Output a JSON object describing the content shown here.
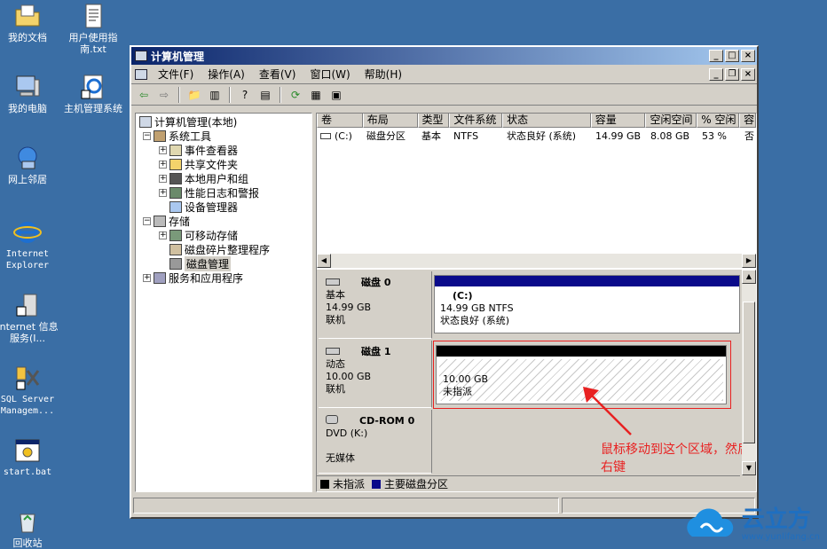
{
  "desktop": {
    "icons": [
      {
        "label": "我的文档"
      },
      {
        "label": "用户使用指南.txt"
      },
      {
        "label": "我的电脑"
      },
      {
        "label": "主机管理系统"
      },
      {
        "label": "网上邻居"
      },
      {
        "label": "Internet Explorer"
      },
      {
        "label": "Internet 信息服务(I..."
      },
      {
        "label": "SQL Server Managem..."
      },
      {
        "label": "start.bat"
      },
      {
        "label": "回收站"
      }
    ]
  },
  "window": {
    "title": "计算机管理",
    "menu": [
      "文件(F)",
      "操作(A)",
      "查看(V)",
      "窗口(W)",
      "帮助(H)"
    ]
  },
  "tree": {
    "root": "计算机管理(本地)",
    "system_tools": "系统工具",
    "event_viewer": "事件查看器",
    "shared_folders": "共享文件夹",
    "local_users": "本地用户和组",
    "perf_logs": "性能日志和警报",
    "device_manager": "设备管理器",
    "storage": "存储",
    "removable": "可移动存储",
    "defrag": "磁盘碎片整理程序",
    "disk_mgmt": "磁盘管理",
    "services": "服务和应用程序"
  },
  "volumes": {
    "headers": [
      "卷",
      "布局",
      "类型",
      "文件系统",
      "状态",
      "容量",
      "空闲空间",
      "% 空闲",
      "容"
    ],
    "rows": [
      [
        "(C:)",
        "磁盘分区",
        "基本",
        "NTFS",
        "状态良好 (系统)",
        "14.99 GB",
        "8.08 GB",
        "53 %",
        "否"
      ]
    ]
  },
  "disks": {
    "disk0": {
      "name": "磁盘 0",
      "type": "基本",
      "size": "14.99 GB",
      "status": "联机",
      "part_label": "(C:)",
      "part_size": "14.99 GB NTFS",
      "part_status": "状态良好 (系统)"
    },
    "disk1": {
      "name": "磁盘 1",
      "type": "动态",
      "size": "10.00 GB",
      "status": "联机",
      "part_size": "10.00 GB",
      "part_status": "未指派"
    },
    "cdrom": {
      "name": "CD-ROM 0",
      "type": "DVD (K:)",
      "status": "无媒体"
    }
  },
  "legend": {
    "unallocated": "未指派",
    "primary": "主要磁盘分区"
  },
  "annotation": "鼠标移动到这个区域，然后右键",
  "brand": {
    "name": "云立方",
    "url": "www.yunlifang.cn"
  },
  "colors": {
    "desktop": "#3a6ea5",
    "primary_partition": "#0a0a8a",
    "annotation": "#e82121"
  }
}
